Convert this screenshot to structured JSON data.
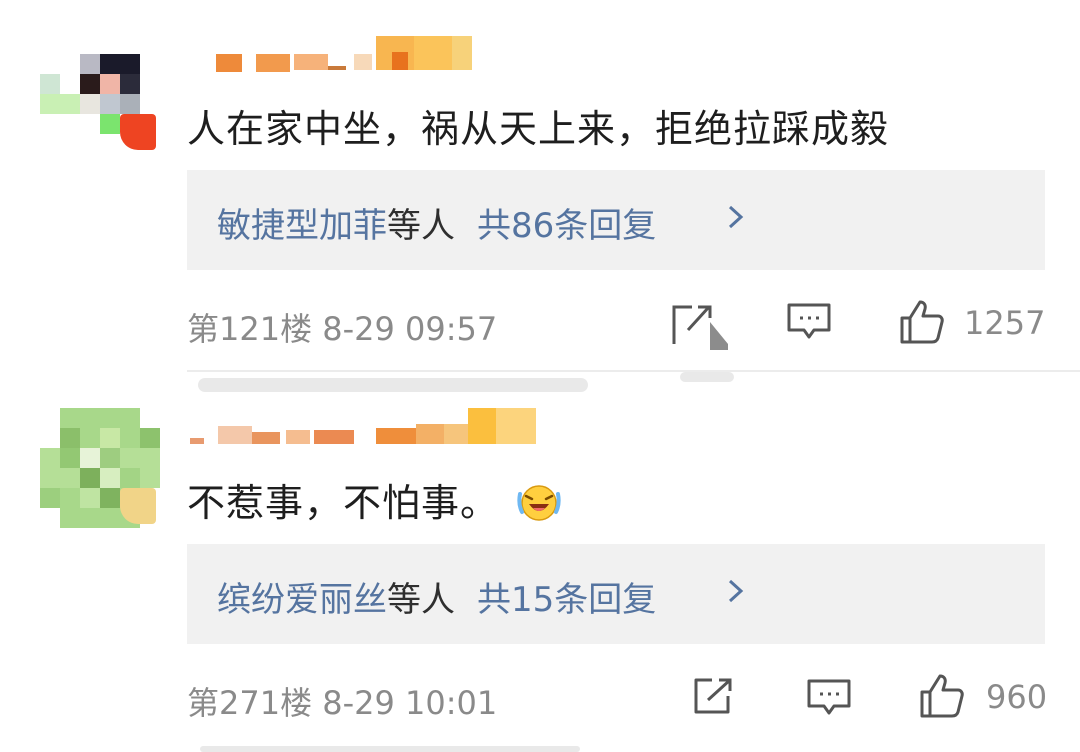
{
  "comments": [
    {
      "content": "人在家中坐，祸从天上来，拒绝拉踩成毅",
      "reply_names": "敏捷型加菲",
      "reply_etc": "等人",
      "reply_count": "共86条回复",
      "floor_time": "第121楼 8-29 09:57",
      "likes": "1257"
    },
    {
      "content": "不惹事，不怕事。",
      "emoji": "laughing-crying-emoji",
      "reply_names": "缤纷爱丽丝",
      "reply_etc": "等人",
      "reply_count": "共15条回复",
      "floor_time": "第271楼 8-29 10:01",
      "likes": "960"
    }
  ],
  "icons": {
    "share": "share-icon",
    "comment": "comment-icon",
    "like": "thumbs-up-icon",
    "chevron": "chevron-right-icon"
  },
  "colors": {
    "link": "#5574a0",
    "meta": "#8a8a8a",
    "reply_bg": "#f1f1f1"
  }
}
